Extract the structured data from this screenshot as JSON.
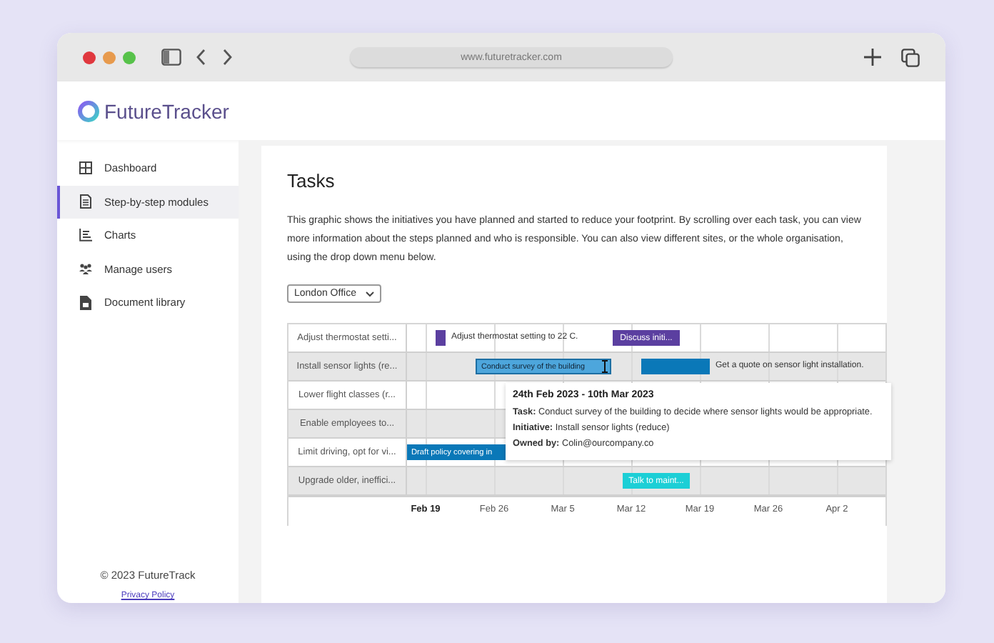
{
  "browser": {
    "url": "www.futuretracker.com"
  },
  "logo": {
    "text": "FutureTracker"
  },
  "sidebar": {
    "items": [
      {
        "label": "Dashboard",
        "selected": false
      },
      {
        "label": "Step-by-step modules",
        "selected": true
      },
      {
        "label": "Charts",
        "selected": false
      },
      {
        "label": "Manage users",
        "selected": false
      },
      {
        "label": "Document library",
        "selected": false
      }
    ],
    "footer": {
      "copyright": "© 2023 FutureTrack",
      "link": "Privacy Policy"
    }
  },
  "page": {
    "title": "Tasks",
    "intro": "This graphic shows the initiatives you have planned and started to reduce your footprint. By scrolling over each task, you can view more information about the steps planned and who is responsible. You can also view different sites, or the whole organisation, using the drop down menu below.",
    "site_select": {
      "value": "London Office"
    }
  },
  "gantt": {
    "ticks": [
      {
        "label": "Feb 19",
        "bold": true
      },
      {
        "label": "Feb 26",
        "bold": false
      },
      {
        "label": "Mar 5",
        "bold": false
      },
      {
        "label": "Mar 12",
        "bold": false
      },
      {
        "label": "Mar 19",
        "bold": false
      },
      {
        "label": "Mar 26",
        "bold": false
      },
      {
        "label": "Apr 2",
        "bold": false
      }
    ],
    "rows": [
      {
        "label": "Adjust thermostat setti...",
        "tasks": [
          {
            "kind": "outside",
            "label": "Adjust thermostat setting to 22 C.",
            "color": "#5b3fa0",
            "hovered": false
          },
          {
            "kind": "inside",
            "label": "Discuss initi...",
            "color": "#5b3fa0",
            "hovered": false
          }
        ]
      },
      {
        "label": "Install sensor lights (re...",
        "tasks": [
          {
            "kind": "inside",
            "label": "Conduct survey of the building",
            "color": "#4da6dc",
            "hovered": true
          },
          {
            "kind": "outside",
            "label": "Get a quote on sensor light installation.",
            "color": "#0a78b8",
            "hovered": false
          }
        ]
      },
      {
        "label": "Lower flight classes (r...",
        "tasks": []
      },
      {
        "label": "Enable employees to...",
        "tasks": []
      },
      {
        "label": "Limit driving, opt for vi...",
        "tasks": [
          {
            "kind": "inside",
            "label": "Draft policy covering in",
            "color": "#0a78b8",
            "hovered": false
          }
        ]
      },
      {
        "label": "Upgrade older, ineffici...",
        "tasks": [
          {
            "kind": "inside",
            "label": "Talk to maint...",
            "color": "#1ccfd6",
            "hovered": false
          }
        ]
      }
    ],
    "tooltip": {
      "dates": "24th Feb 2023 - 10th Mar 2023",
      "fields": [
        {
          "label": "Task:",
          "value": "Conduct survey of the building to decide where sensor lights would be appropriate."
        },
        {
          "label": "Initiative:",
          "value": "Install sensor lights (reduce)"
        },
        {
          "label": "Owned by:",
          "value": "Colin@ourcompany.co"
        }
      ]
    }
  }
}
